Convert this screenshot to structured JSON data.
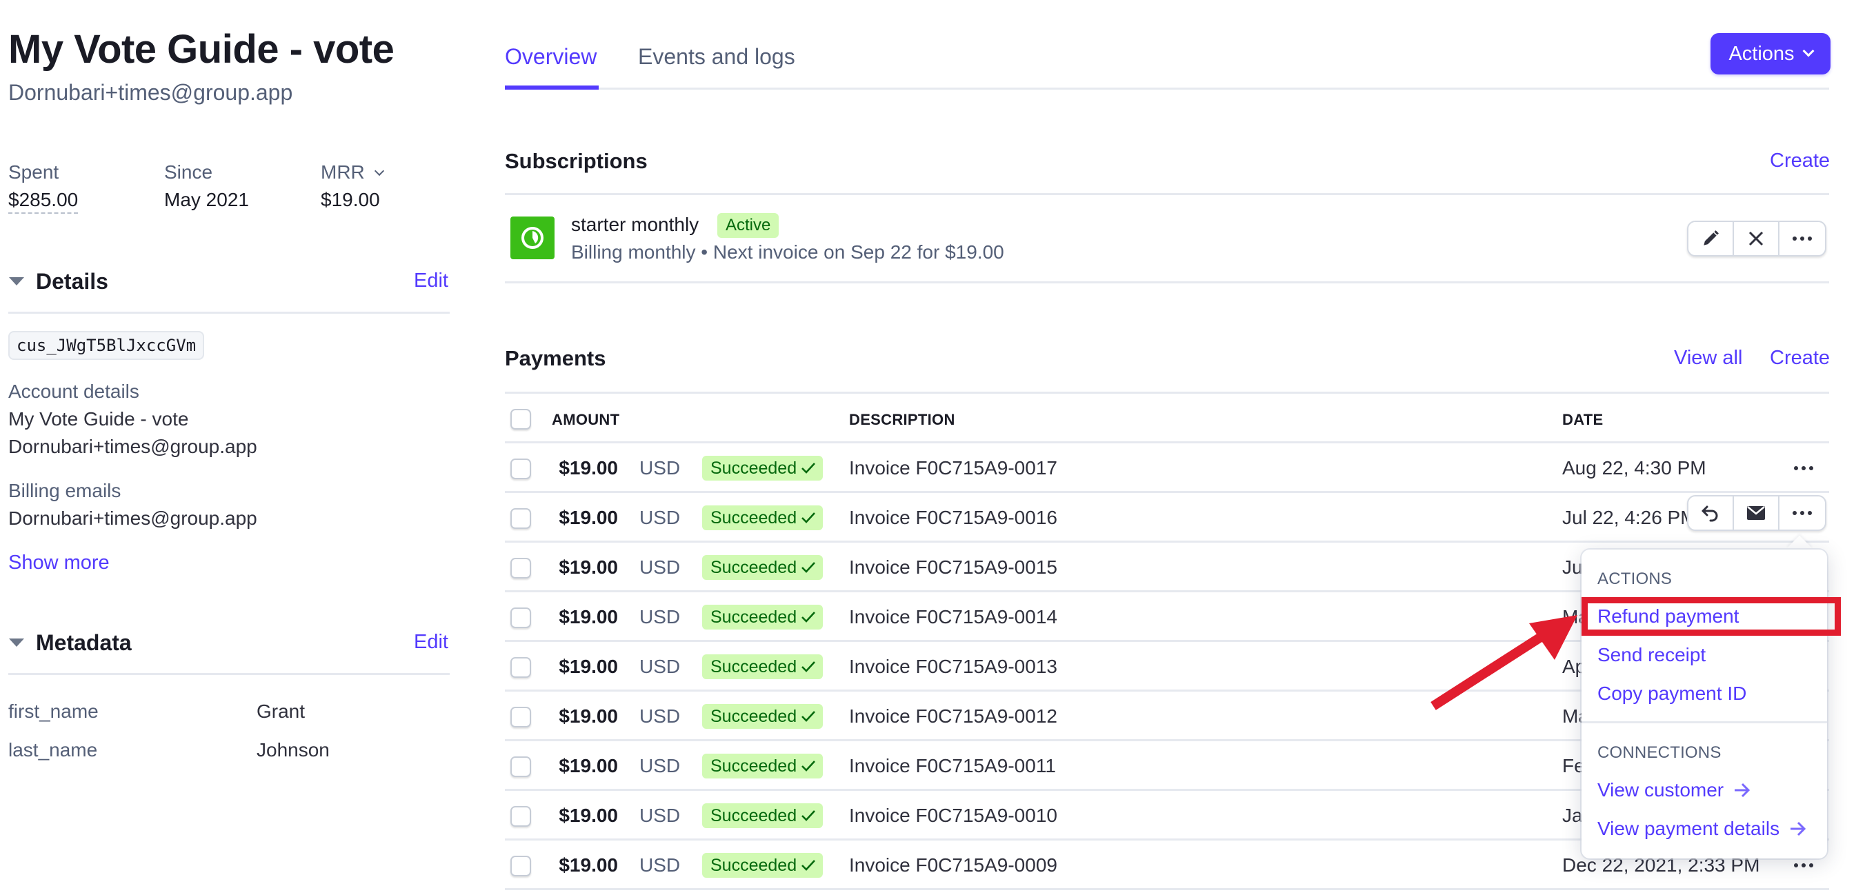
{
  "customer": {
    "name": "My Vote Guide - vote",
    "email": "Dornubari+times@group.app"
  },
  "stats": [
    {
      "label": "Spent",
      "value": "$285.00"
    },
    {
      "label": "Since",
      "value": "May 2021"
    },
    {
      "label": "MRR",
      "value": "$19.00"
    }
  ],
  "details": {
    "heading": "Details",
    "edit_label": "Edit",
    "customer_id": "cus_JWgT5BlJxccGVm",
    "account_details_label": "Account details",
    "account_name": "My Vote Guide - vote",
    "account_email": "Dornubari+times@group.app",
    "billing_emails_label": "Billing emails",
    "billing_email": "Dornubari+times@group.app",
    "show_more_label": "Show more"
  },
  "metadata": {
    "heading": "Metadata",
    "edit_label": "Edit",
    "entries": [
      {
        "key": "first_name",
        "value": "Grant"
      },
      {
        "key": "last_name",
        "value": "Johnson"
      }
    ]
  },
  "tabs": [
    {
      "label": "Overview",
      "active": true
    },
    {
      "label": "Events and logs",
      "active": false
    }
  ],
  "actions_button": {
    "label": "Actions",
    "icon": "chevron-down-icon"
  },
  "subscriptions": {
    "heading": "Subscriptions",
    "create_label": "Create",
    "items": [
      {
        "name": "starter monthly",
        "status": "Active",
        "detail": "Billing monthly • Next invoice on Sep 22 for $19.00",
        "icon": "clock-icon",
        "accent": "#3bbd17"
      }
    ],
    "row_actions": [
      "pencil-icon",
      "close-icon",
      "more-icon"
    ]
  },
  "payments": {
    "heading": "Payments",
    "view_all_label": "View all",
    "create_label": "Create",
    "columns": [
      "AMOUNT",
      "DESCRIPTION",
      "DATE"
    ],
    "rows": [
      {
        "amount": "$19.00",
        "currency": "USD",
        "status": "Succeeded",
        "description": "Invoice F0C715A9-0017",
        "date": "Aug 22, 4:30 PM"
      },
      {
        "amount": "$19.00",
        "currency": "USD",
        "status": "Succeeded",
        "description": "Invoice F0C715A9-0016",
        "date": "Jul 22, 4:26 PM"
      },
      {
        "amount": "$19.00",
        "currency": "USD",
        "status": "Succeeded",
        "description": "Invoice F0C715A9-0015",
        "date": "Ju"
      },
      {
        "amount": "$19.00",
        "currency": "USD",
        "status": "Succeeded",
        "description": "Invoice F0C715A9-0014",
        "date": "Ma"
      },
      {
        "amount": "$19.00",
        "currency": "USD",
        "status": "Succeeded",
        "description": "Invoice F0C715A9-0013",
        "date": "Ap"
      },
      {
        "amount": "$19.00",
        "currency": "USD",
        "status": "Succeeded",
        "description": "Invoice F0C715A9-0012",
        "date": "Ma"
      },
      {
        "amount": "$19.00",
        "currency": "USD",
        "status": "Succeeded",
        "description": "Invoice F0C715A9-0011",
        "date": "Fe"
      },
      {
        "amount": "$19.00",
        "currency": "USD",
        "status": "Succeeded",
        "description": "Invoice F0C715A9-0010",
        "date": "Ja"
      },
      {
        "amount": "$19.00",
        "currency": "USD",
        "status": "Succeeded",
        "description": "Invoice F0C715A9-0009",
        "date": "Dec 22, 2021, 2:33 PM"
      }
    ],
    "hover_row_actions": [
      "refund-icon",
      "mail-icon",
      "more-icon"
    ]
  },
  "context_menu": {
    "actions_heading": "ACTIONS",
    "actions": [
      "Refund payment",
      "Send receipt",
      "Copy payment ID"
    ],
    "connections_heading": "CONNECTIONS",
    "connections": [
      "View customer",
      "View payment details"
    ],
    "highlighted_item": "Refund payment"
  },
  "colors": {
    "accent": "#533afd",
    "success_bg": "#d1fab3",
    "success_text": "#05690d",
    "annotation_red": "#e11d2e"
  }
}
